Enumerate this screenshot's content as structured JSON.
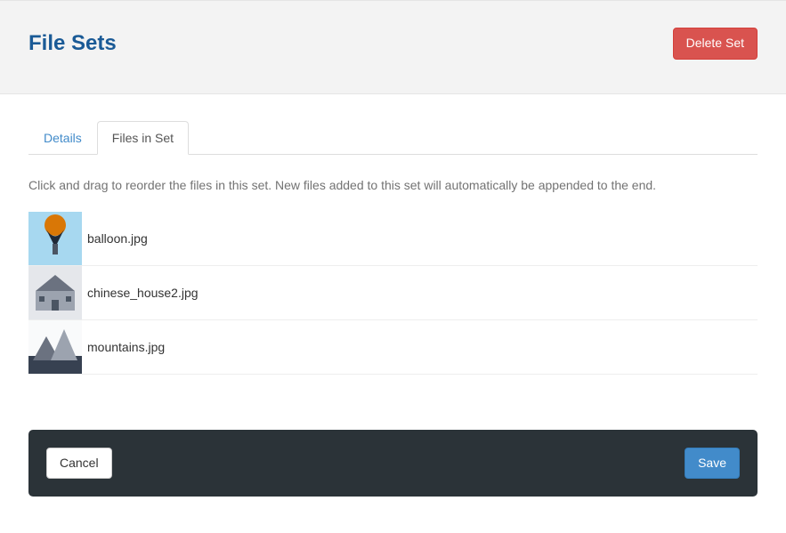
{
  "header": {
    "title": "File Sets",
    "delete_label": "Delete Set"
  },
  "tabs": {
    "details": "Details",
    "files": "Files in Set"
  },
  "instructions": "Click and drag to reorder the files in this set. New files added to this set will automatically be appended to the end.",
  "files": [
    {
      "name": "balloon.jpg"
    },
    {
      "name": "chinese_house2.jpg"
    },
    {
      "name": "mountains.jpg"
    }
  ],
  "footer": {
    "cancel_label": "Cancel",
    "save_label": "Save"
  }
}
